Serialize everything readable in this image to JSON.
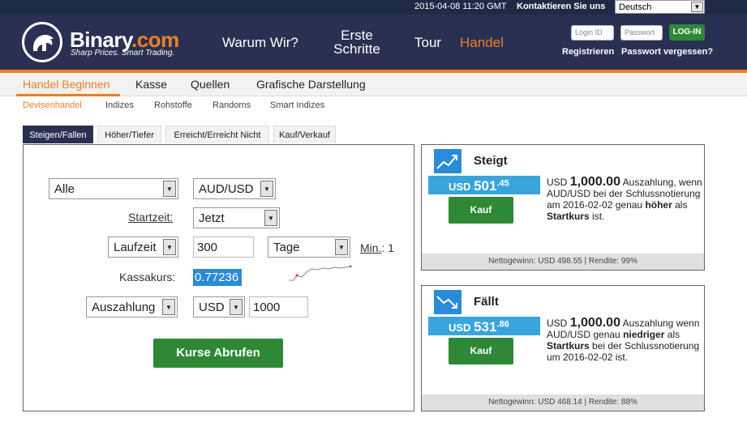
{
  "topbar": {
    "datetime": "2015-04-08 11:20 GMT",
    "contact": "Kontaktieren Sie uns",
    "language": "Deutsch"
  },
  "header": {
    "brand_main": "Binary",
    "brand_suffix": ".com",
    "tagline": "Sharp Prices. Smart Trading.",
    "nav": [
      "Warum Wir?",
      "Erste Schritte",
      "Tour",
      "Handel"
    ],
    "login_placeholder": "Login ID",
    "password_placeholder": "Passwort",
    "login_button": "LOG-IN",
    "register": "Registrieren",
    "forgot": "Passwort vergessen?"
  },
  "menu": [
    "Handel Beginnen",
    "Kasse",
    "Quellen",
    "Grafische Darstellung"
  ],
  "submenu": [
    "Devisenhandel",
    "Indizes",
    "Rohstoffe",
    "Randoms",
    "Smart Indizes"
  ],
  "tabs": [
    "Steigen/Fallen",
    "Höher/Tiefer",
    "Erreicht/Erreicht Nicht",
    "Kauf/Verkauf"
  ],
  "form": {
    "market": "Alle",
    "underlying": "AUD/USD",
    "start_label": "Startzeit:",
    "start_value": "Jetzt",
    "duration_type": "Laufzeit",
    "duration_value": "300",
    "duration_unit": "Tage",
    "min_label": "Min.",
    "min_value": ": 1",
    "spot_label": "Kassakurs:",
    "spot_value": "0.77236",
    "payout_type": "Auszahlung",
    "currency": "USD",
    "amount": "1000",
    "get_prices": "Kurse Abrufen"
  },
  "contracts": [
    {
      "title": "Steigt",
      "currency": "USD",
      "price_main": "501",
      "price_dec": ".45",
      "buy": "Kauf",
      "payout_ccy": "USD",
      "payout_amount": "1,000.00",
      "desc_1": "Auszahlung, wenn AUD/USD bei der Schlussnotierung am 2016-02-02 genau",
      "desc_bold1": "höher",
      "desc_2": "als",
      "desc_bold2": "Startkurs",
      "desc_3": "ist.",
      "footer": "Nettogewinn: USD 498.55 | Rendite: 99%",
      "icon": "trend-up-icon"
    },
    {
      "title": "Fällt",
      "currency": "USD",
      "price_main": "531",
      "price_dec": ".86",
      "buy": "Kauf",
      "payout_ccy": "USD",
      "payout_amount": "1,000.00",
      "desc_1": "Auszahlung wenn AUD/USD genau",
      "desc_bold1": "niedriger",
      "desc_2": "als",
      "desc_bold2": "Startkurs",
      "desc_3": "bei der Schlussnotierung um 2016-02-02 ist.",
      "footer": "Nettogewinn: USD 468.14 | Rendite: 88%",
      "icon": "trend-down-icon"
    }
  ],
  "colors": {
    "navy": "#2a3052",
    "orange": "#e98024",
    "green": "#2e8836",
    "blue": "#39a4dc"
  }
}
